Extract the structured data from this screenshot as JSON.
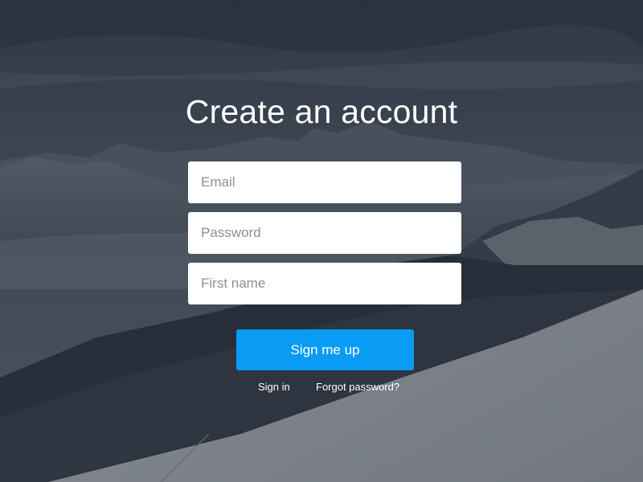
{
  "page": {
    "title": "Create an account"
  },
  "form": {
    "email_placeholder": "Email",
    "password_placeholder": "Password",
    "first_name_placeholder": "First name",
    "submit_label": "Sign me up"
  },
  "links": {
    "sign_in": "Sign in",
    "forgot_password": "Forgot password?"
  },
  "colors": {
    "primary_button": "#0a9bf5",
    "input_background": "#ffffff",
    "text_on_background": "#ffffff"
  }
}
